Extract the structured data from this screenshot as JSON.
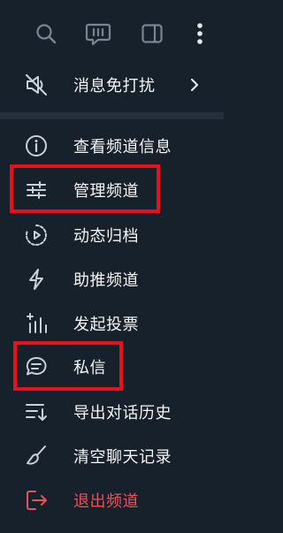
{
  "menu": {
    "mute": "消息免打扰",
    "view_info": "查看频道信息",
    "manage": "管理频道",
    "stories": "动态归档",
    "boost": "助推频道",
    "poll": "发起投票",
    "private_msg": "私信",
    "export": "导出对话历史",
    "clear": "清空聊天记录",
    "leave": "退出频道"
  },
  "colors": {
    "background": "#17212b",
    "separator": "#242f3d",
    "icon": "#c8d0d8",
    "danger": "#e5535b",
    "highlight": "#e8101b"
  },
  "icons": {
    "top": [
      "search-icon",
      "chat-bubble-icon",
      "sidebar-toggle-icon",
      "more-vertical-icon"
    ]
  }
}
